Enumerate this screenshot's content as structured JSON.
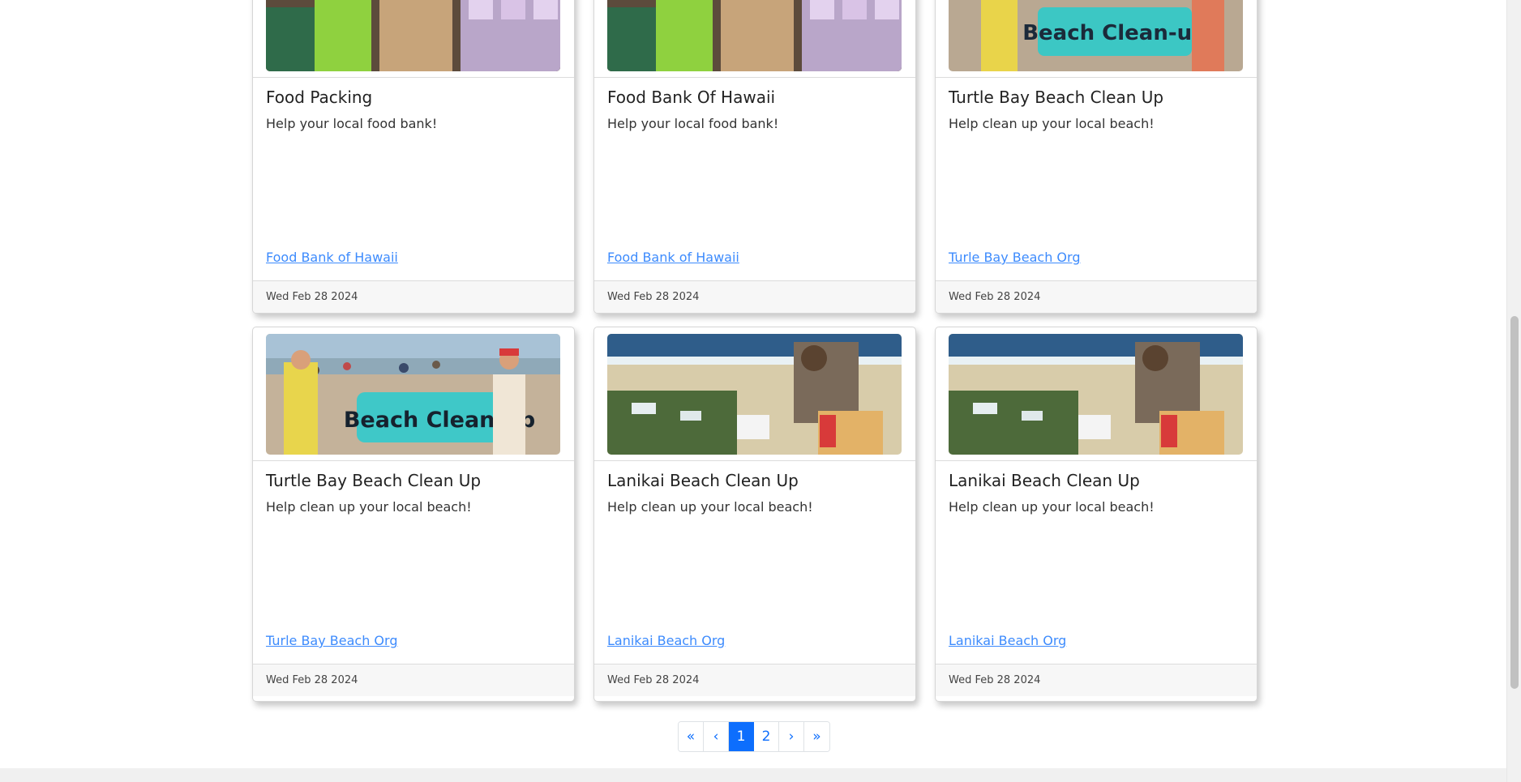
{
  "cards": [
    {
      "title": "Food Packing",
      "description": "Help your local food bank!",
      "org": "Food Bank of Hawaii",
      "date": "Wed Feb 28 2024",
      "image": "food-bank-photo"
    },
    {
      "title": "Food Bank Of Hawaii",
      "description": "Help your local food bank!",
      "org": "Food Bank of Hawaii",
      "date": "Wed Feb 28 2024",
      "image": "food-bank-photo"
    },
    {
      "title": "Turtle Bay Beach Clean Up",
      "description": "Help clean up your local beach!",
      "org": "Turle Bay Beach Org",
      "date": "Wed Feb 28 2024",
      "image": "beach-clean-up-sign-photo"
    },
    {
      "title": "Turtle Bay Beach Clean Up",
      "description": "Help clean up your local beach!",
      "org": "Turle Bay Beach Org",
      "date": "Wed Feb 28 2024",
      "image": "beach-clean-up-sign-photo"
    },
    {
      "title": "Lanikai Beach Clean Up",
      "description": "Help clean up your local beach!",
      "org": "Lanikai Beach Org",
      "date": "Wed Feb 28 2024",
      "image": "beach-trash-photo"
    },
    {
      "title": "Lanikai Beach Clean Up",
      "description": "Help clean up your local beach!",
      "org": "Lanikai Beach Org",
      "date": "Wed Feb 28 2024",
      "image": "beach-trash-photo"
    }
  ],
  "sign_text": "Beach Clean-up",
  "pagination": {
    "first": "«",
    "prev": "‹",
    "pages": [
      "1",
      "2"
    ],
    "active_page": "1",
    "next": "›",
    "last": "»"
  },
  "colors": {
    "link": "#3d8bfd",
    "primary": "#0d6efd"
  }
}
